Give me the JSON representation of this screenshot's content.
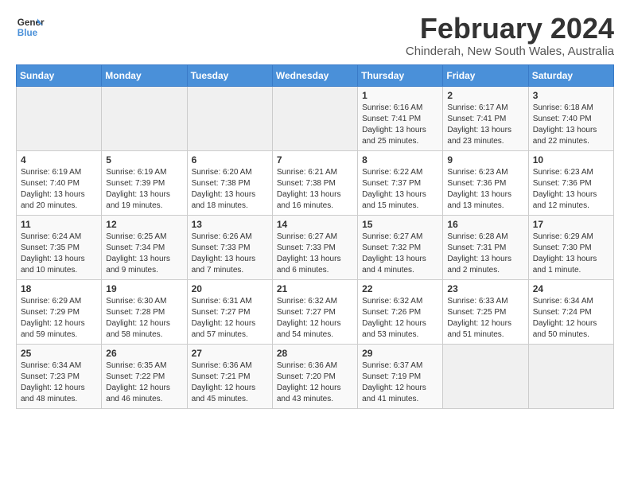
{
  "logo": {
    "line1": "General",
    "line2": "Blue"
  },
  "title": "February 2024",
  "subtitle": "Chinderah, New South Wales, Australia",
  "days_of_week": [
    "Sunday",
    "Monday",
    "Tuesday",
    "Wednesday",
    "Thursday",
    "Friday",
    "Saturday"
  ],
  "weeks": [
    [
      {
        "day": "",
        "info": ""
      },
      {
        "day": "",
        "info": ""
      },
      {
        "day": "",
        "info": ""
      },
      {
        "day": "",
        "info": ""
      },
      {
        "day": "1",
        "info": "Sunrise: 6:16 AM\nSunset: 7:41 PM\nDaylight: 13 hours\nand 25 minutes."
      },
      {
        "day": "2",
        "info": "Sunrise: 6:17 AM\nSunset: 7:41 PM\nDaylight: 13 hours\nand 23 minutes."
      },
      {
        "day": "3",
        "info": "Sunrise: 6:18 AM\nSunset: 7:40 PM\nDaylight: 13 hours\nand 22 minutes."
      }
    ],
    [
      {
        "day": "4",
        "info": "Sunrise: 6:19 AM\nSunset: 7:40 PM\nDaylight: 13 hours\nand 20 minutes."
      },
      {
        "day": "5",
        "info": "Sunrise: 6:19 AM\nSunset: 7:39 PM\nDaylight: 13 hours\nand 19 minutes."
      },
      {
        "day": "6",
        "info": "Sunrise: 6:20 AM\nSunset: 7:38 PM\nDaylight: 13 hours\nand 18 minutes."
      },
      {
        "day": "7",
        "info": "Sunrise: 6:21 AM\nSunset: 7:38 PM\nDaylight: 13 hours\nand 16 minutes."
      },
      {
        "day": "8",
        "info": "Sunrise: 6:22 AM\nSunset: 7:37 PM\nDaylight: 13 hours\nand 15 minutes."
      },
      {
        "day": "9",
        "info": "Sunrise: 6:23 AM\nSunset: 7:36 PM\nDaylight: 13 hours\nand 13 minutes."
      },
      {
        "day": "10",
        "info": "Sunrise: 6:23 AM\nSunset: 7:36 PM\nDaylight: 13 hours\nand 12 minutes."
      }
    ],
    [
      {
        "day": "11",
        "info": "Sunrise: 6:24 AM\nSunset: 7:35 PM\nDaylight: 13 hours\nand 10 minutes."
      },
      {
        "day": "12",
        "info": "Sunrise: 6:25 AM\nSunset: 7:34 PM\nDaylight: 13 hours\nand 9 minutes."
      },
      {
        "day": "13",
        "info": "Sunrise: 6:26 AM\nSunset: 7:33 PM\nDaylight: 13 hours\nand 7 minutes."
      },
      {
        "day": "14",
        "info": "Sunrise: 6:27 AM\nSunset: 7:33 PM\nDaylight: 13 hours\nand 6 minutes."
      },
      {
        "day": "15",
        "info": "Sunrise: 6:27 AM\nSunset: 7:32 PM\nDaylight: 13 hours\nand 4 minutes."
      },
      {
        "day": "16",
        "info": "Sunrise: 6:28 AM\nSunset: 7:31 PM\nDaylight: 13 hours\nand 2 minutes."
      },
      {
        "day": "17",
        "info": "Sunrise: 6:29 AM\nSunset: 7:30 PM\nDaylight: 13 hours\nand 1 minute."
      }
    ],
    [
      {
        "day": "18",
        "info": "Sunrise: 6:29 AM\nSunset: 7:29 PM\nDaylight: 12 hours\nand 59 minutes."
      },
      {
        "day": "19",
        "info": "Sunrise: 6:30 AM\nSunset: 7:28 PM\nDaylight: 12 hours\nand 58 minutes."
      },
      {
        "day": "20",
        "info": "Sunrise: 6:31 AM\nSunset: 7:27 PM\nDaylight: 12 hours\nand 57 minutes."
      },
      {
        "day": "21",
        "info": "Sunrise: 6:32 AM\nSunset: 7:27 PM\nDaylight: 12 hours\nand 54 minutes."
      },
      {
        "day": "22",
        "info": "Sunrise: 6:32 AM\nSunset: 7:26 PM\nDaylight: 12 hours\nand 53 minutes."
      },
      {
        "day": "23",
        "info": "Sunrise: 6:33 AM\nSunset: 7:25 PM\nDaylight: 12 hours\nand 51 minutes."
      },
      {
        "day": "24",
        "info": "Sunrise: 6:34 AM\nSunset: 7:24 PM\nDaylight: 12 hours\nand 50 minutes."
      }
    ],
    [
      {
        "day": "25",
        "info": "Sunrise: 6:34 AM\nSunset: 7:23 PM\nDaylight: 12 hours\nand 48 minutes."
      },
      {
        "day": "26",
        "info": "Sunrise: 6:35 AM\nSunset: 7:22 PM\nDaylight: 12 hours\nand 46 minutes."
      },
      {
        "day": "27",
        "info": "Sunrise: 6:36 AM\nSunset: 7:21 PM\nDaylight: 12 hours\nand 45 minutes."
      },
      {
        "day": "28",
        "info": "Sunrise: 6:36 AM\nSunset: 7:20 PM\nDaylight: 12 hours\nand 43 minutes."
      },
      {
        "day": "29",
        "info": "Sunrise: 6:37 AM\nSunset: 7:19 PM\nDaylight: 12 hours\nand 41 minutes."
      },
      {
        "day": "",
        "info": ""
      },
      {
        "day": "",
        "info": ""
      }
    ]
  ]
}
